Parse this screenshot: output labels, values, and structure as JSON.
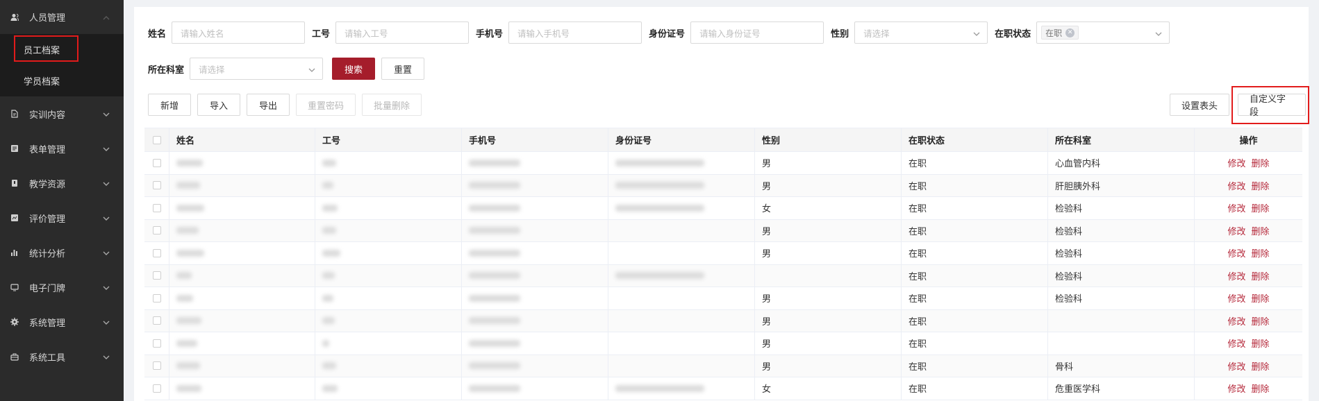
{
  "sidebar": {
    "items": [
      {
        "label": "人员管理",
        "icon": "user-icon",
        "open": true,
        "sub": [
          {
            "label": "员工档案",
            "active": true
          },
          {
            "label": "学员档案",
            "active": false
          }
        ]
      },
      {
        "label": "实训内容",
        "icon": "book-icon"
      },
      {
        "label": "表单管理",
        "icon": "form-icon"
      },
      {
        "label": "教学资源",
        "icon": "resource-icon"
      },
      {
        "label": "评价管理",
        "icon": "evaluate-icon"
      },
      {
        "label": "统计分析",
        "icon": "bar-chart-icon"
      },
      {
        "label": "电子门牌",
        "icon": "monitor-icon"
      },
      {
        "label": "系统管理",
        "icon": "gear-icon"
      },
      {
        "label": "系统工具",
        "icon": "toolbox-icon"
      }
    ]
  },
  "filters": {
    "name": {
      "label": "姓名",
      "placeholder": "请输入姓名"
    },
    "emp_no": {
      "label": "工号",
      "placeholder": "请输入工号"
    },
    "phone": {
      "label": "手机号",
      "placeholder": "请输入手机号"
    },
    "id_card": {
      "label": "身份证号",
      "placeholder": "请输入身份证号"
    },
    "gender": {
      "label": "性别",
      "placeholder": "请选择"
    },
    "status": {
      "label": "在职状态",
      "tag": "在职"
    },
    "dept": {
      "label": "所在科室",
      "placeholder": "请选择"
    },
    "search_label": "搜索",
    "reset_label": "重置"
  },
  "toolbar": {
    "add": "新增",
    "import": "导入",
    "export": "导出",
    "reset_pwd": "重置密码",
    "batch_delete": "批量删除",
    "set_header": "设置表头",
    "custom_field": "自定义字段"
  },
  "table": {
    "columns": [
      "姓名",
      "工号",
      "手机号",
      "身份证号",
      "性别",
      "在职状态",
      "所在科室",
      "操作"
    ],
    "edit_label": "修改",
    "delete_label": "删除",
    "rows": [
      {
        "gender": "男",
        "status": "在职",
        "dept": "心血管内科",
        "has_card": true
      },
      {
        "gender": "男",
        "status": "在职",
        "dept": "肝胆胰外科",
        "has_card": true
      },
      {
        "gender": "女",
        "status": "在职",
        "dept": "检验科",
        "has_card": true
      },
      {
        "gender": "男",
        "status": "在职",
        "dept": "检验科",
        "has_card": false
      },
      {
        "gender": "男",
        "status": "在职",
        "dept": "检验科",
        "has_card": false
      },
      {
        "gender": "",
        "status": "在职",
        "dept": "检验科",
        "has_card": true
      },
      {
        "gender": "男",
        "status": "在职",
        "dept": "检验科",
        "has_card": false
      },
      {
        "gender": "男",
        "status": "在职",
        "dept": "",
        "has_card": false
      },
      {
        "gender": "男",
        "status": "在职",
        "dept": "",
        "has_card": false
      },
      {
        "gender": "男",
        "status": "在职",
        "dept": "骨科",
        "has_card": false
      },
      {
        "gender": "女",
        "status": "在职",
        "dept": "危重医学科",
        "has_card": true
      }
    ]
  }
}
